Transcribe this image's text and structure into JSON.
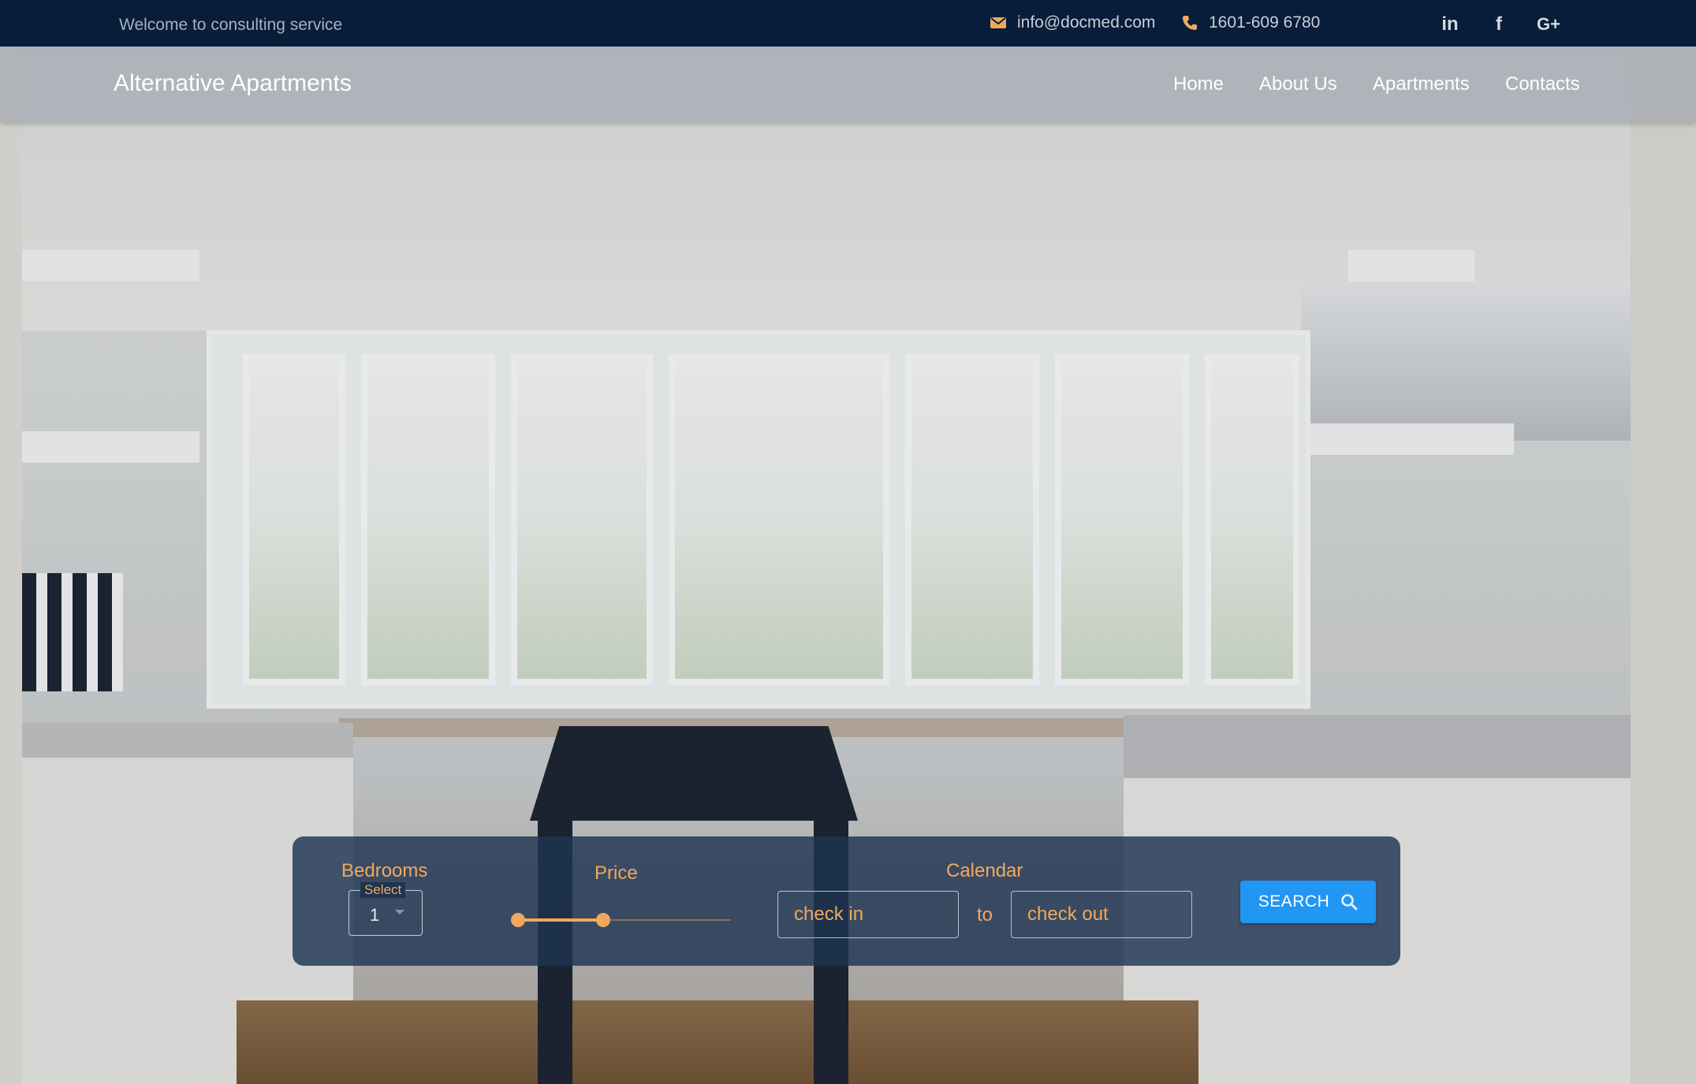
{
  "topbar": {
    "welcome": "Welcome to consulting service",
    "email": "info@docmed.com",
    "phone": "1601-609 6780",
    "social": [
      "linkedin-icon",
      "facebook-icon",
      "google-plus-icon"
    ],
    "linkedin_label": "in",
    "facebook_label": "f",
    "google_label": "G+"
  },
  "nav": {
    "brand": "Alternative Apartments",
    "items": [
      "Home",
      "About Us",
      "Apartments",
      "Contacts"
    ]
  },
  "search": {
    "bedrooms_label": "Bedrooms",
    "bedrooms_legend": "Select",
    "bedrooms_value": "1",
    "price_label": "Price",
    "calendar_label": "Calendar",
    "check_in_placeholder": "check in",
    "to_label": "to",
    "check_out_placeholder": "check out",
    "button_label": "SEARCH"
  },
  "colors": {
    "topbar_bg": "#071d3a",
    "accent": "#f2a85b",
    "button": "#2196f3",
    "panel_bg": "#1e3452"
  }
}
